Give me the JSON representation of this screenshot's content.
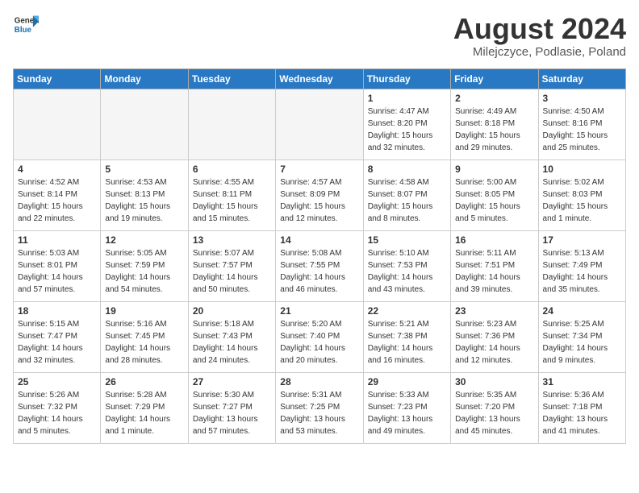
{
  "header": {
    "logo_line1": "General",
    "logo_line2": "Blue",
    "title": "August 2024",
    "subtitle": "Milejczyce, Podlasie, Poland"
  },
  "weekdays": [
    "Sunday",
    "Monday",
    "Tuesday",
    "Wednesday",
    "Thursday",
    "Friday",
    "Saturday"
  ],
  "weeks": [
    [
      {
        "day": "",
        "info": ""
      },
      {
        "day": "",
        "info": ""
      },
      {
        "day": "",
        "info": ""
      },
      {
        "day": "",
        "info": ""
      },
      {
        "day": "1",
        "info": "Sunrise: 4:47 AM\nSunset: 8:20 PM\nDaylight: 15 hours\nand 32 minutes."
      },
      {
        "day": "2",
        "info": "Sunrise: 4:49 AM\nSunset: 8:18 PM\nDaylight: 15 hours\nand 29 minutes."
      },
      {
        "day": "3",
        "info": "Sunrise: 4:50 AM\nSunset: 8:16 PM\nDaylight: 15 hours\nand 25 minutes."
      }
    ],
    [
      {
        "day": "4",
        "info": "Sunrise: 4:52 AM\nSunset: 8:14 PM\nDaylight: 15 hours\nand 22 minutes."
      },
      {
        "day": "5",
        "info": "Sunrise: 4:53 AM\nSunset: 8:13 PM\nDaylight: 15 hours\nand 19 minutes."
      },
      {
        "day": "6",
        "info": "Sunrise: 4:55 AM\nSunset: 8:11 PM\nDaylight: 15 hours\nand 15 minutes."
      },
      {
        "day": "7",
        "info": "Sunrise: 4:57 AM\nSunset: 8:09 PM\nDaylight: 15 hours\nand 12 minutes."
      },
      {
        "day": "8",
        "info": "Sunrise: 4:58 AM\nSunset: 8:07 PM\nDaylight: 15 hours\nand 8 minutes."
      },
      {
        "day": "9",
        "info": "Sunrise: 5:00 AM\nSunset: 8:05 PM\nDaylight: 15 hours\nand 5 minutes."
      },
      {
        "day": "10",
        "info": "Sunrise: 5:02 AM\nSunset: 8:03 PM\nDaylight: 15 hours\nand 1 minute."
      }
    ],
    [
      {
        "day": "11",
        "info": "Sunrise: 5:03 AM\nSunset: 8:01 PM\nDaylight: 14 hours\nand 57 minutes."
      },
      {
        "day": "12",
        "info": "Sunrise: 5:05 AM\nSunset: 7:59 PM\nDaylight: 14 hours\nand 54 minutes."
      },
      {
        "day": "13",
        "info": "Sunrise: 5:07 AM\nSunset: 7:57 PM\nDaylight: 14 hours\nand 50 minutes."
      },
      {
        "day": "14",
        "info": "Sunrise: 5:08 AM\nSunset: 7:55 PM\nDaylight: 14 hours\nand 46 minutes."
      },
      {
        "day": "15",
        "info": "Sunrise: 5:10 AM\nSunset: 7:53 PM\nDaylight: 14 hours\nand 43 minutes."
      },
      {
        "day": "16",
        "info": "Sunrise: 5:11 AM\nSunset: 7:51 PM\nDaylight: 14 hours\nand 39 minutes."
      },
      {
        "day": "17",
        "info": "Sunrise: 5:13 AM\nSunset: 7:49 PM\nDaylight: 14 hours\nand 35 minutes."
      }
    ],
    [
      {
        "day": "18",
        "info": "Sunrise: 5:15 AM\nSunset: 7:47 PM\nDaylight: 14 hours\nand 32 minutes."
      },
      {
        "day": "19",
        "info": "Sunrise: 5:16 AM\nSunset: 7:45 PM\nDaylight: 14 hours\nand 28 minutes."
      },
      {
        "day": "20",
        "info": "Sunrise: 5:18 AM\nSunset: 7:43 PM\nDaylight: 14 hours\nand 24 minutes."
      },
      {
        "day": "21",
        "info": "Sunrise: 5:20 AM\nSunset: 7:40 PM\nDaylight: 14 hours\nand 20 minutes."
      },
      {
        "day": "22",
        "info": "Sunrise: 5:21 AM\nSunset: 7:38 PM\nDaylight: 14 hours\nand 16 minutes."
      },
      {
        "day": "23",
        "info": "Sunrise: 5:23 AM\nSunset: 7:36 PM\nDaylight: 14 hours\nand 12 minutes."
      },
      {
        "day": "24",
        "info": "Sunrise: 5:25 AM\nSunset: 7:34 PM\nDaylight: 14 hours\nand 9 minutes."
      }
    ],
    [
      {
        "day": "25",
        "info": "Sunrise: 5:26 AM\nSunset: 7:32 PM\nDaylight: 14 hours\nand 5 minutes."
      },
      {
        "day": "26",
        "info": "Sunrise: 5:28 AM\nSunset: 7:29 PM\nDaylight: 14 hours\nand 1 minute."
      },
      {
        "day": "27",
        "info": "Sunrise: 5:30 AM\nSunset: 7:27 PM\nDaylight: 13 hours\nand 57 minutes."
      },
      {
        "day": "28",
        "info": "Sunrise: 5:31 AM\nSunset: 7:25 PM\nDaylight: 13 hours\nand 53 minutes."
      },
      {
        "day": "29",
        "info": "Sunrise: 5:33 AM\nSunset: 7:23 PM\nDaylight: 13 hours\nand 49 minutes."
      },
      {
        "day": "30",
        "info": "Sunrise: 5:35 AM\nSunset: 7:20 PM\nDaylight: 13 hours\nand 45 minutes."
      },
      {
        "day": "31",
        "info": "Sunrise: 5:36 AM\nSunset: 7:18 PM\nDaylight: 13 hours\nand 41 minutes."
      }
    ]
  ]
}
